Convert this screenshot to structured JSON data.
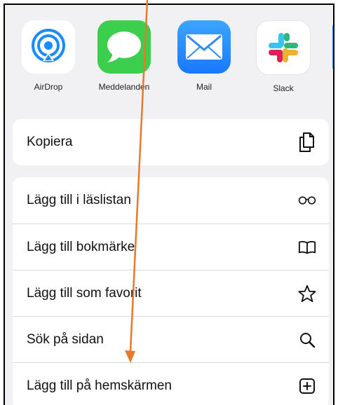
{
  "apps": [
    {
      "label": "AirDrop",
      "icon": "airdrop-icon"
    },
    {
      "label": "Meddelanden",
      "icon": "messages-icon"
    },
    {
      "label": "Mail",
      "icon": "mail-icon"
    },
    {
      "label": "Slack",
      "icon": "slack-icon"
    }
  ],
  "actions_top": [
    {
      "label": "Kopiera",
      "icon": "copy-icon"
    }
  ],
  "actions": [
    {
      "label": "Lägg till i läslistan",
      "icon": "glasses-icon"
    },
    {
      "label": "Lägg till bokmärke",
      "icon": "book-icon"
    },
    {
      "label": "Lägg till som favorit",
      "icon": "star-icon"
    },
    {
      "label": "Sök på sidan",
      "icon": "search-icon"
    },
    {
      "label": "Lägg till på hemskärmen",
      "icon": "add-square-icon"
    }
  ],
  "colors": {
    "annotation_arrow": "#e8782a",
    "messages_green": "#3ccf4e",
    "mail_blue": "#1f8bff",
    "airdrop_blue": "#1a8cff"
  }
}
